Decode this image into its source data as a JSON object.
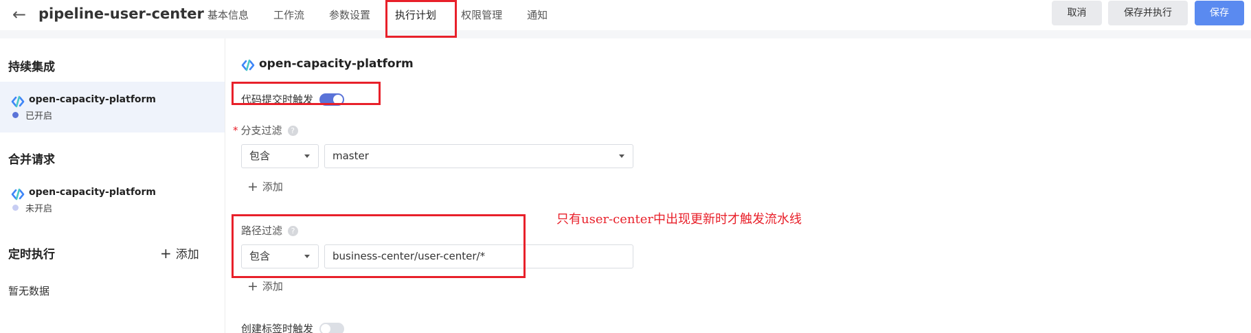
{
  "header": {
    "back_icon": "arrow-left-icon",
    "title": "pipeline-user-center",
    "tabs": [
      {
        "label": "基本信息"
      },
      {
        "label": "工作流"
      },
      {
        "label": "参数设置"
      },
      {
        "label": "执行计划",
        "active": true
      },
      {
        "label": "权限管理"
      },
      {
        "label": "通知"
      }
    ],
    "cancel_label": "取消",
    "save_run_label": "保存并执行",
    "save_label": "保存",
    "primary_color": "#5a8af0"
  },
  "sidebar": {
    "ci_title": "持续集成",
    "ci_item": {
      "name": "open-capacity-platform",
      "status": "已开启",
      "status_color": "#5a73d8",
      "icon": "pipeline-link-icon"
    },
    "mr_title": "合并请求",
    "mr_item": {
      "name": "open-capacity-platform",
      "status": "未开启",
      "status_color": "#c7cdf3",
      "icon": "pipeline-link-icon"
    },
    "timer_title": "定时执行",
    "timer_add_label": "添加",
    "timer_empty": "暂无数据"
  },
  "main": {
    "title": "open-capacity-platform",
    "commit_trigger_label": "代码提交时触发",
    "commit_trigger_on": true,
    "branch_filter": {
      "required_mark": "*",
      "label": "分支过滤",
      "mode": "包含",
      "value": "master",
      "add_label": "添加"
    },
    "path_filter": {
      "label": "路径过滤",
      "mode": "包含",
      "value": "business-center/user-center/*",
      "add_label": "添加"
    },
    "tag_trigger_label": "创建标签时触发",
    "tag_trigger_on": false,
    "annotation": "只有user-center中出现更新时才触发流水线",
    "highlight_color": "#e8202a"
  }
}
